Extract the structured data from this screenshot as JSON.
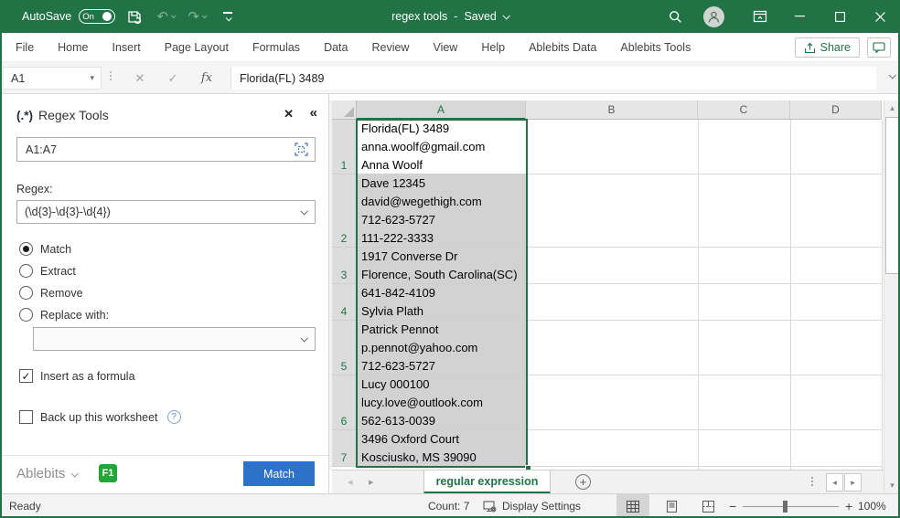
{
  "titlebar": {
    "autosave_label": "AutoSave",
    "autosave_state": "On",
    "doc_title": "regex tools",
    "separator": "-",
    "doc_status": "Saved"
  },
  "ribbon": {
    "tabs": [
      "File",
      "Home",
      "Insert",
      "Page Layout",
      "Formulas",
      "Data",
      "Review",
      "View",
      "Help",
      "Ablebits Data",
      "Ablebits Tools"
    ],
    "share_label": "Share"
  },
  "formula_bar": {
    "name_box": "A1",
    "cancel": "✕",
    "enter": "✓",
    "fx_label": "fx",
    "formula": "Florida(FL) 3489"
  },
  "pane": {
    "icon_text": "(.*)",
    "title": "Regex Tools",
    "close": "✕",
    "collapse": "«",
    "range_value": "A1:A7",
    "regex_label": "Regex:",
    "regex_value": "(\\d{3}-\\d{3}-\\d{4})",
    "option_match": "Match",
    "option_extract": "Extract",
    "option_remove": "Remove",
    "option_replace": "Replace with:",
    "replace_value": "",
    "check_mark": "✓",
    "insert_formula_label": "Insert as a formula",
    "backup_label": "Back up this worksheet",
    "help_mark": "?",
    "brand": "Ablebits",
    "f1_badge": "F1",
    "action_button": "Match"
  },
  "grid": {
    "columns": [
      "A",
      "B",
      "C",
      "D"
    ],
    "rows": [
      {
        "num": "1",
        "lines": [
          "Florida(FL) 3489",
          "anna.woolf@gmail.com",
          "Anna Woolf"
        ]
      },
      {
        "num": "2",
        "lines": [
          "Dave 12345",
          "david@wegethigh.com",
          "712-623-5727",
          "111-222-3333"
        ]
      },
      {
        "num": "3",
        "lines": [
          "1917 Converse Dr",
          "Florence, South Carolina(SC)"
        ]
      },
      {
        "num": "4",
        "lines": [
          "641-842-4109",
          "Sylvia Plath"
        ]
      },
      {
        "num": "5",
        "lines": [
          "Patrick Pennot",
          "p.pennot@yahoo.com",
          "712-623-5727"
        ]
      },
      {
        "num": "6",
        "lines": [
          "Lucy 000100",
          "lucy.love@outlook.com",
          "562-613-0039"
        ]
      },
      {
        "num": "7",
        "lines": [
          "3496 Oxford Court",
          "Kosciusko, MS 39090"
        ]
      }
    ]
  },
  "sheet_bar": {
    "active_tab": "regular expression",
    "add_label": "+"
  },
  "status_bar": {
    "ready": "Ready",
    "count": "Count: 7",
    "display_settings": "Display Settings",
    "zoom_level": "100%",
    "minus": "−",
    "plus": "+"
  },
  "colors": {
    "accent_green": "#217346",
    "action_blue": "#2b72c9",
    "badge_green": "#23a638",
    "selection_gray": "#d2d2d2"
  }
}
